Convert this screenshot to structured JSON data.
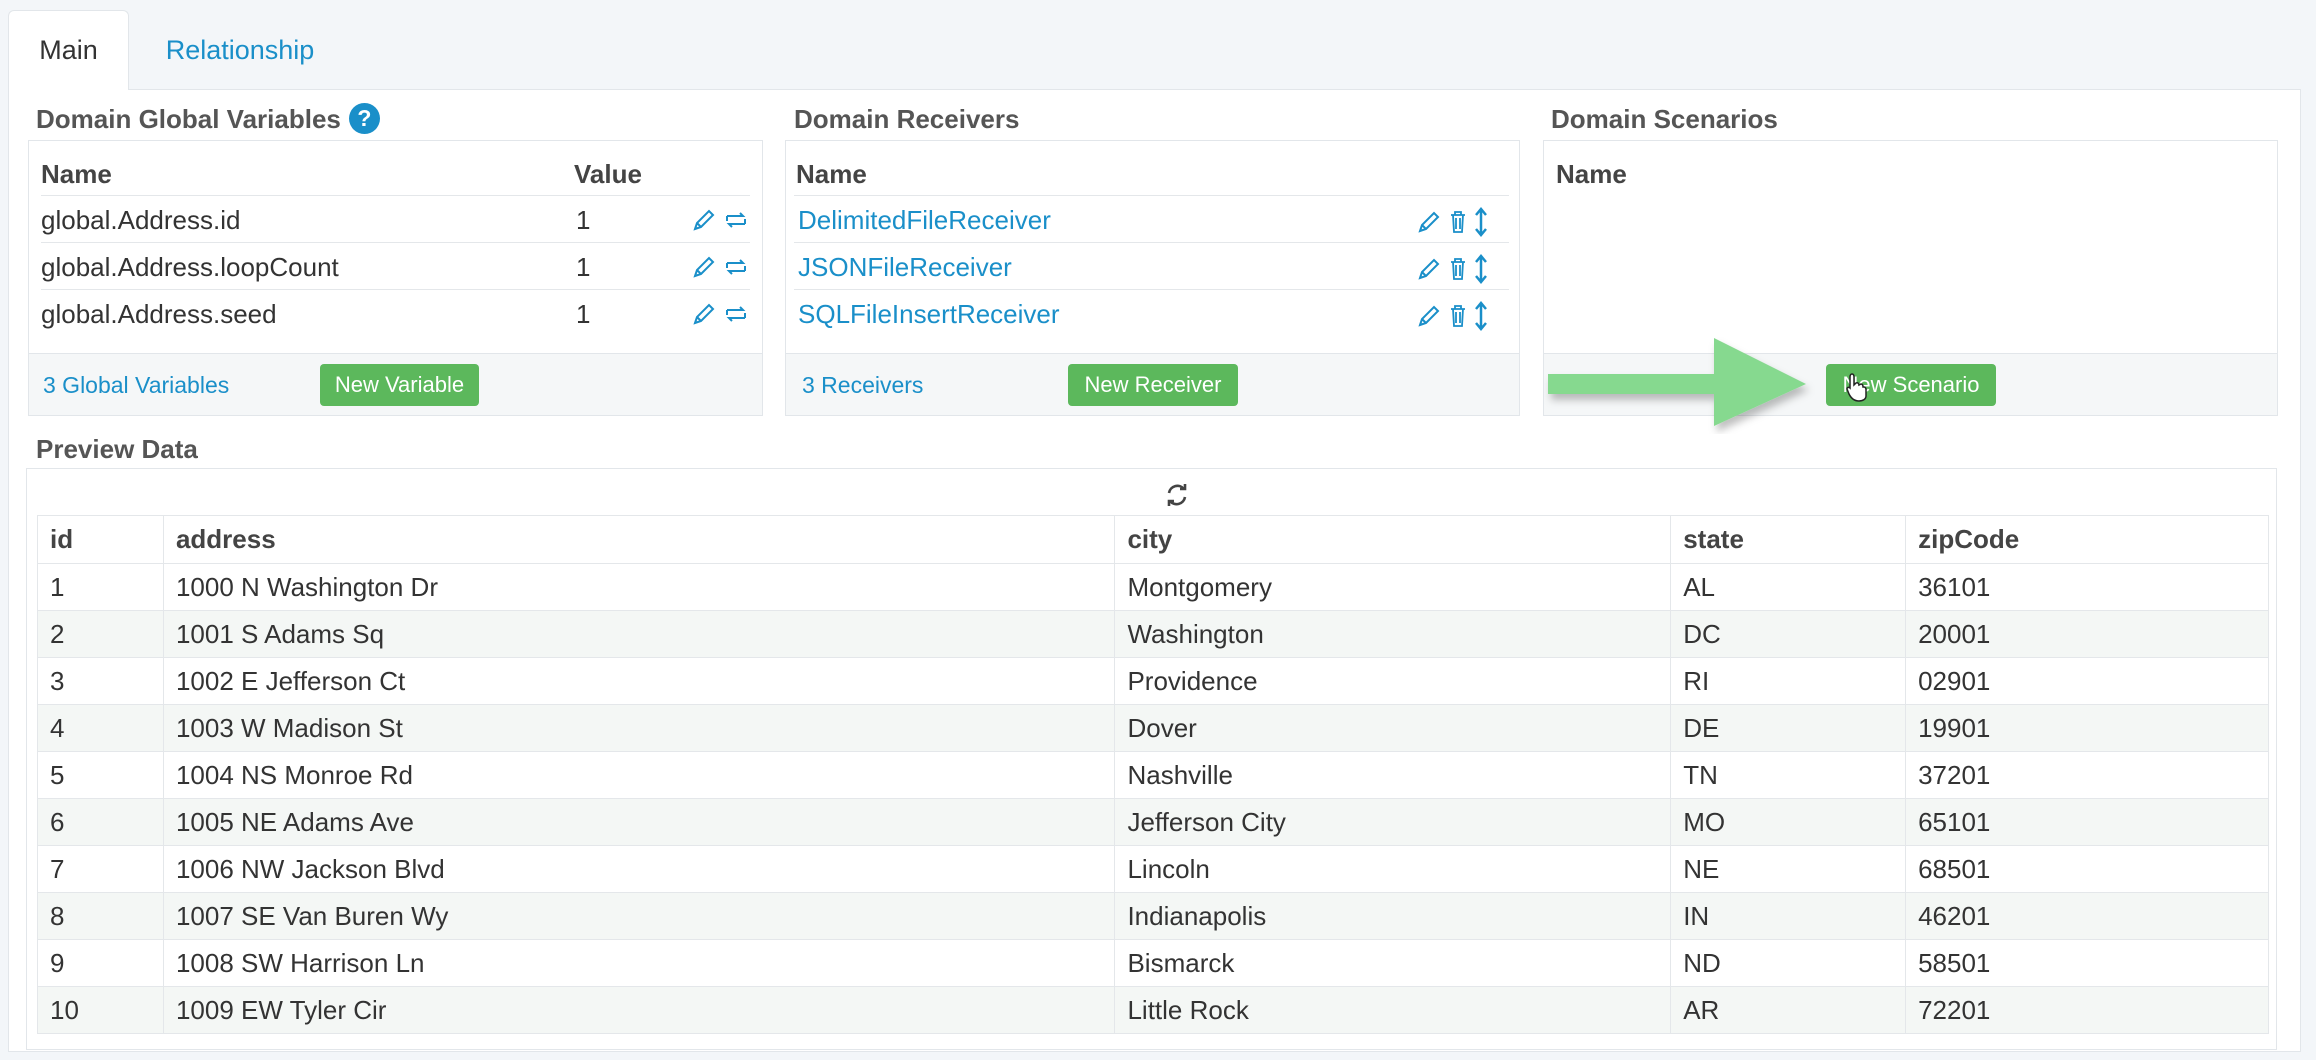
{
  "tabs": [
    {
      "label": "Main"
    },
    {
      "label": "Relationship"
    }
  ],
  "global_vars": {
    "title": "Domain Global Variables",
    "help_glyph": "?",
    "columns": {
      "name": "Name",
      "value": "Value"
    },
    "rows": [
      {
        "name": "global.Address.id",
        "value": "1"
      },
      {
        "name": "global.Address.loopCount",
        "value": "1"
      },
      {
        "name": "global.Address.seed",
        "value": "1"
      }
    ],
    "footer_link": "3 Global Variables",
    "new_button": "New Variable"
  },
  "receivers": {
    "title": "Domain Receivers",
    "columns": {
      "name": "Name"
    },
    "rows": [
      {
        "name": "DelimitedFileReceiver"
      },
      {
        "name": "JSONFileReceiver"
      },
      {
        "name": "SQLFileInsertReceiver"
      }
    ],
    "footer_link": "3 Receivers",
    "new_button": "New Receiver"
  },
  "scenarios": {
    "title": "Domain Scenarios",
    "columns": {
      "name": "Name"
    },
    "new_button": "New Scenario"
  },
  "preview": {
    "title": "Preview Data",
    "columns": [
      "id",
      "address",
      "city",
      "state",
      "zipCode"
    ],
    "rows": [
      [
        "1",
        "1000 N Washington Dr",
        "Montgomery",
        "AL",
        "36101"
      ],
      [
        "2",
        "1001 S Adams Sq",
        "Washington",
        "DC",
        "20001"
      ],
      [
        "3",
        "1002 E Jefferson Ct",
        "Providence",
        "RI",
        "02901"
      ],
      [
        "4",
        "1003 W Madison St",
        "Dover",
        "DE",
        "19901"
      ],
      [
        "5",
        "1004 NS Monroe Rd",
        "Nashville",
        "TN",
        "37201"
      ],
      [
        "6",
        "1005 NE Adams Ave",
        "Jefferson City",
        "MO",
        "65101"
      ],
      [
        "7",
        "1006 NW Jackson Blvd",
        "Lincoln",
        "NE",
        "68501"
      ],
      [
        "8",
        "1007 SE Van Buren Wy",
        "Indianapolis",
        "IN",
        "46201"
      ],
      [
        "9",
        "1008 SW Harrison Ln",
        "Bismarck",
        "ND",
        "58501"
      ],
      [
        "10",
        "1009 EW Tyler Cir",
        "Little Rock",
        "AR",
        "72201"
      ]
    ]
  },
  "colors": {
    "link": "#1a8fc9",
    "button": "#5cb85c",
    "arrow": "#86d98f"
  },
  "icons": [
    "pencil-icon",
    "swap-icon",
    "trash-icon",
    "reorder-icon",
    "refresh-icon",
    "help-icon",
    "arrow-pointer",
    "cursor-icon"
  ]
}
